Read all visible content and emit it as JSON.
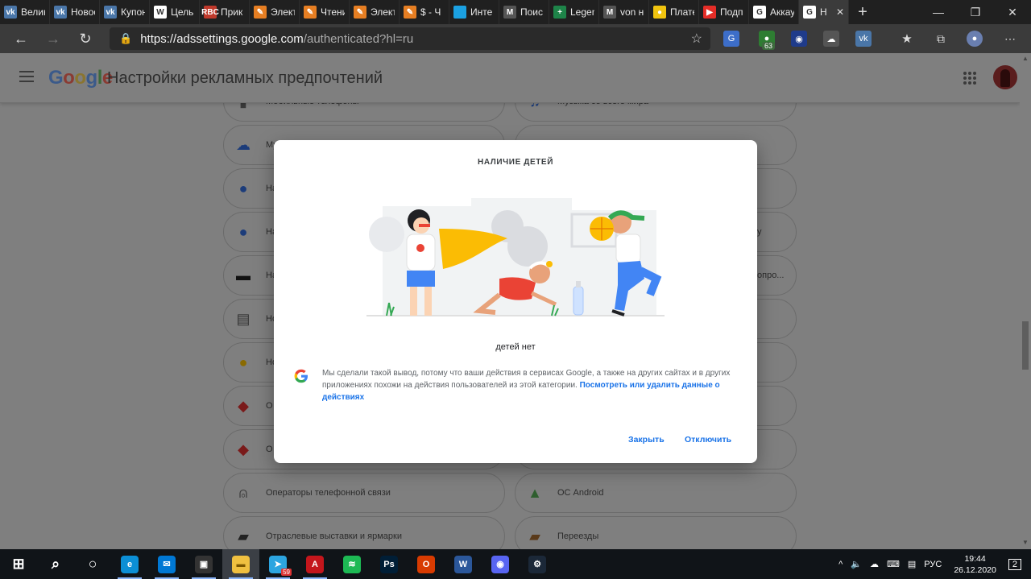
{
  "tabs": [
    {
      "label": "Велик",
      "icon": "vk-icon",
      "icon_text": "vk",
      "color": "#4a76a8"
    },
    {
      "label": "Новости",
      "icon": "vk-icon",
      "icon_text": "vk",
      "color": "#4a76a8"
    },
    {
      "label": "Купон",
      "icon": "vk-icon",
      "icon_text": "vk",
      "color": "#4a76a8"
    },
    {
      "label": "Цель",
      "icon": "wiki-icon",
      "icon_text": "W",
      "color": "#ffffff"
    },
    {
      "label": "Прик",
      "icon": "rbc-icon",
      "icon_text": "RBC",
      "color": "#c0392b"
    },
    {
      "label": "Элект",
      "icon": "pencil-icon",
      "icon_text": "✎",
      "color": "#e67e22"
    },
    {
      "label": "Чтени",
      "icon": "pencil-icon",
      "icon_text": "✎",
      "color": "#e67e22"
    },
    {
      "label": "Элект",
      "icon": "pencil-icon",
      "icon_text": "✎",
      "color": "#e67e22"
    },
    {
      "label": "$ - Ч",
      "icon": "pencil-icon",
      "icon_text": "✎",
      "color": "#e67e22"
    },
    {
      "label": "Инте",
      "icon": "square-icon",
      "icon_text": "",
      "color": "#1ba1e2"
    },
    {
      "label": "Поис",
      "icon": "m-icon",
      "icon_text": "M",
      "color": "#555555"
    },
    {
      "label": "Legen",
      "icon": "plus-icon",
      "icon_text": "+",
      "color": "#1e8449"
    },
    {
      "label": "von н",
      "icon": "m-icon",
      "icon_text": "M",
      "color": "#555555"
    },
    {
      "label": "Плате",
      "icon": "yellow-icon",
      "icon_text": "●",
      "color": "#f1c40f"
    },
    {
      "label": "Подп",
      "icon": "youtube-icon",
      "icon_text": "▶",
      "color": "#e52d27"
    },
    {
      "label": "Аккау",
      "icon": "google-icon",
      "icon_text": "G",
      "color": "#ffffff"
    },
    {
      "label": "Н",
      "icon": "google-icon",
      "icon_text": "G",
      "color": "#ffffff"
    }
  ],
  "address": {
    "host": "https://adssettings.google.com",
    "path": "/authenticated?hl=ru"
  },
  "extensions": {
    "badge": "63"
  },
  "header": {
    "logo_letters": [
      {
        "ch": "G",
        "color": "#3b5a8a"
      },
      {
        "ch": "o",
        "color": "#8a3b33"
      },
      {
        "ch": "o",
        "color": "#8a7530"
      },
      {
        "ch": "g",
        "color": "#3b5a8a"
      },
      {
        "ch": "l",
        "color": "#3b6a3b"
      },
      {
        "ch": "e",
        "color": "#8a3b33"
      }
    ],
    "title": "Настройки рекламных предпочтений"
  },
  "cards": [
    {
      "label": "Мобильные телефоны",
      "icon": "phone-icon",
      "glyph": "▮"
    },
    {
      "label": "Музыка со всего мира",
      "icon": "music-note-icon",
      "glyph": "♫"
    },
    {
      "label": "Му",
      "icon": "cloud-music-icon",
      "glyph": "☁"
    },
    {
      "label": "",
      "icon": "blank-icon",
      "glyph": ""
    },
    {
      "label": "На",
      "icon": "person-icon",
      "glyph": "●"
    },
    {
      "label": "",
      "icon": "blank-icon",
      "glyph": ""
    },
    {
      "label": "На",
      "icon": "people-icon",
      "glyph": "●"
    },
    {
      "label": "у",
      "icon": "blank-icon",
      "glyph": ""
    },
    {
      "label": "На",
      "icon": "clapperboard-icon",
      "glyph": "▬"
    },
    {
      "label": "опро...",
      "icon": "blank-icon",
      "glyph": ""
    },
    {
      "label": "Но",
      "icon": "newspaper-icon",
      "glyph": "▤"
    },
    {
      "label": "",
      "icon": "blank-icon",
      "glyph": ""
    },
    {
      "label": "Но",
      "icon": "coin-icon",
      "glyph": "●"
    },
    {
      "label": "",
      "icon": "blank-icon",
      "glyph": ""
    },
    {
      "label": "О",
      "icon": "price-tag-icon",
      "glyph": "◆"
    },
    {
      "label": "",
      "icon": "blank-icon",
      "glyph": ""
    },
    {
      "label": "О",
      "icon": "price-tag-icon",
      "glyph": "◆"
    },
    {
      "label": "",
      "icon": "blank-icon",
      "glyph": ""
    },
    {
      "label": "Операторы телефонной связи",
      "icon": "antenna-icon",
      "glyph": "⍝"
    },
    {
      "label": "ОС Android",
      "icon": "android-icon",
      "glyph": "▲"
    },
    {
      "label": "Отраслевые выставки и ярмарки",
      "icon": "briefcase-icon",
      "glyph": "▰"
    },
    {
      "label": "Переезды",
      "icon": "hand-truck-icon",
      "glyph": "▰"
    }
  ],
  "dialog": {
    "title": "НАЛИЧИЕ ДЕТЕЙ",
    "status": "детей нет",
    "body": "Мы сделали такой вывод, потому что ваши действия в сервисах Google, а также на других сайтах и в других приложениях похожи на действия пользователей из этой категории.",
    "link": "Посмотреть или удалить данные о действиях",
    "close_label": "Закрыть",
    "disable_label": "Отключить"
  },
  "taskbar": {
    "items": [
      {
        "name": "start-button",
        "icon": "windows-icon"
      },
      {
        "name": "search-button",
        "icon": "search-icon"
      },
      {
        "name": "cortana-button",
        "icon": "cortana-icon"
      },
      {
        "name": "edge-app",
        "icon": "edge-icon"
      },
      {
        "name": "mail-app",
        "icon": "mail-icon"
      },
      {
        "name": "store-app",
        "icon": "store-icon"
      },
      {
        "name": "explorer-app",
        "icon": "folder-icon"
      },
      {
        "name": "telegram-app",
        "icon": "telegram-icon",
        "badge": "59"
      },
      {
        "name": "acrobat-app",
        "icon": "acrobat-icon"
      },
      {
        "name": "spotify-app",
        "icon": "spotify-icon"
      },
      {
        "name": "photoshop-app",
        "icon": "photoshop-icon"
      },
      {
        "name": "office-app",
        "icon": "office-icon"
      },
      {
        "name": "word-app",
        "icon": "word-icon"
      },
      {
        "name": "discord-app",
        "icon": "discord-icon"
      },
      {
        "name": "steam-app",
        "icon": "steam-icon"
      }
    ],
    "lang": "РУС",
    "time": "19:44",
    "date": "26.12.2020",
    "notifications": "2"
  }
}
